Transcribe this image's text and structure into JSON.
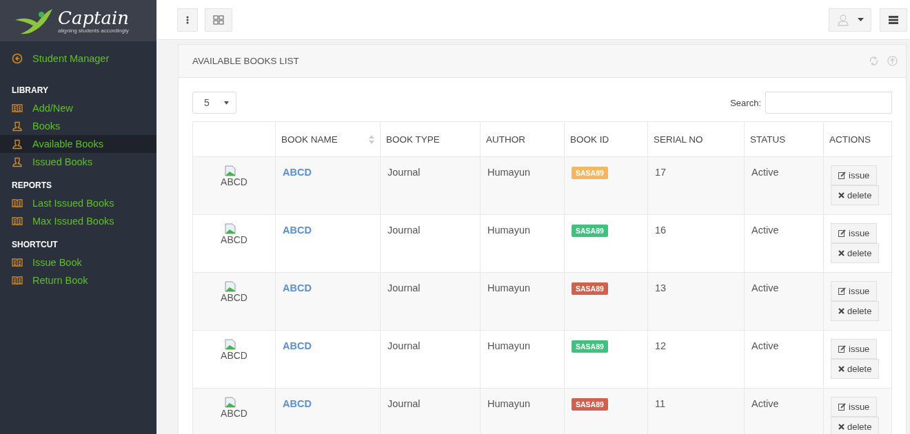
{
  "logo": {
    "name": "Captain",
    "tagline": "aligning students accordingly"
  },
  "sidebar": {
    "back": {
      "label": "Student Manager"
    },
    "sections": [
      {
        "title": "LIBRARY",
        "items": [
          {
            "label": "Add/New",
            "kind": "book",
            "selected": false
          },
          {
            "label": "Books",
            "kind": "user",
            "selected": false
          },
          {
            "label": "Available Books",
            "kind": "user",
            "selected": true
          },
          {
            "label": "Issued Books",
            "kind": "user",
            "selected": false
          }
        ]
      },
      {
        "title": "REPORTS",
        "items": [
          {
            "label": "Last Issued Books",
            "kind": "book",
            "selected": false
          },
          {
            "label": "Max Issued Books",
            "kind": "book",
            "selected": false
          }
        ]
      },
      {
        "title": "SHORTCUT",
        "items": [
          {
            "label": "Issue Book",
            "kind": "book",
            "selected": false
          },
          {
            "label": "Return Book",
            "kind": "book",
            "selected": false
          }
        ]
      }
    ]
  },
  "panel": {
    "title": "AVAILABLE BOOKS LIST",
    "page_size": "5",
    "search_label": "Search:"
  },
  "table": {
    "columns": [
      "",
      "BOOK NAME",
      "BOOK TYPE",
      "AUTHOR",
      "BOOK ID",
      "SERIAL NO",
      "STATUS",
      "ACTIONS"
    ],
    "rows": [
      {
        "image_alt": "ABCD",
        "name": "ABCD",
        "type": "Journal",
        "author": "Humayun",
        "book_id": "SASA89",
        "color": "#f6b55e",
        "serial": "17",
        "status": "Active",
        "actions": [
          "issue",
          "delete"
        ]
      },
      {
        "image_alt": "ABCD",
        "name": "ABCD",
        "type": "Journal",
        "author": "Humayun",
        "book_id": "SASA89",
        "color": "#3fc27e",
        "serial": "16",
        "status": "Active",
        "actions": [
          "issue",
          "delete"
        ]
      },
      {
        "image_alt": "ABCD",
        "name": "ABCD",
        "type": "Journal",
        "author": "Humayun",
        "book_id": "SASA89",
        "color": "#d35f4f",
        "serial": "13",
        "status": "Active",
        "actions": [
          "issue",
          "delete"
        ]
      },
      {
        "image_alt": "ABCD",
        "name": "ABCD",
        "type": "Journal",
        "author": "Humayun",
        "book_id": "SASA89",
        "color": "#3fc27e",
        "serial": "12",
        "status": "Active",
        "actions": [
          "issue",
          "delete"
        ]
      },
      {
        "image_alt": "ABCD",
        "name": "ABCD",
        "type": "Journal",
        "author": "Humayun",
        "book_id": "SASA89",
        "color": "#d35f4f",
        "serial": "11",
        "status": "Active",
        "actions": [
          "issue",
          "delete"
        ]
      }
    ]
  }
}
